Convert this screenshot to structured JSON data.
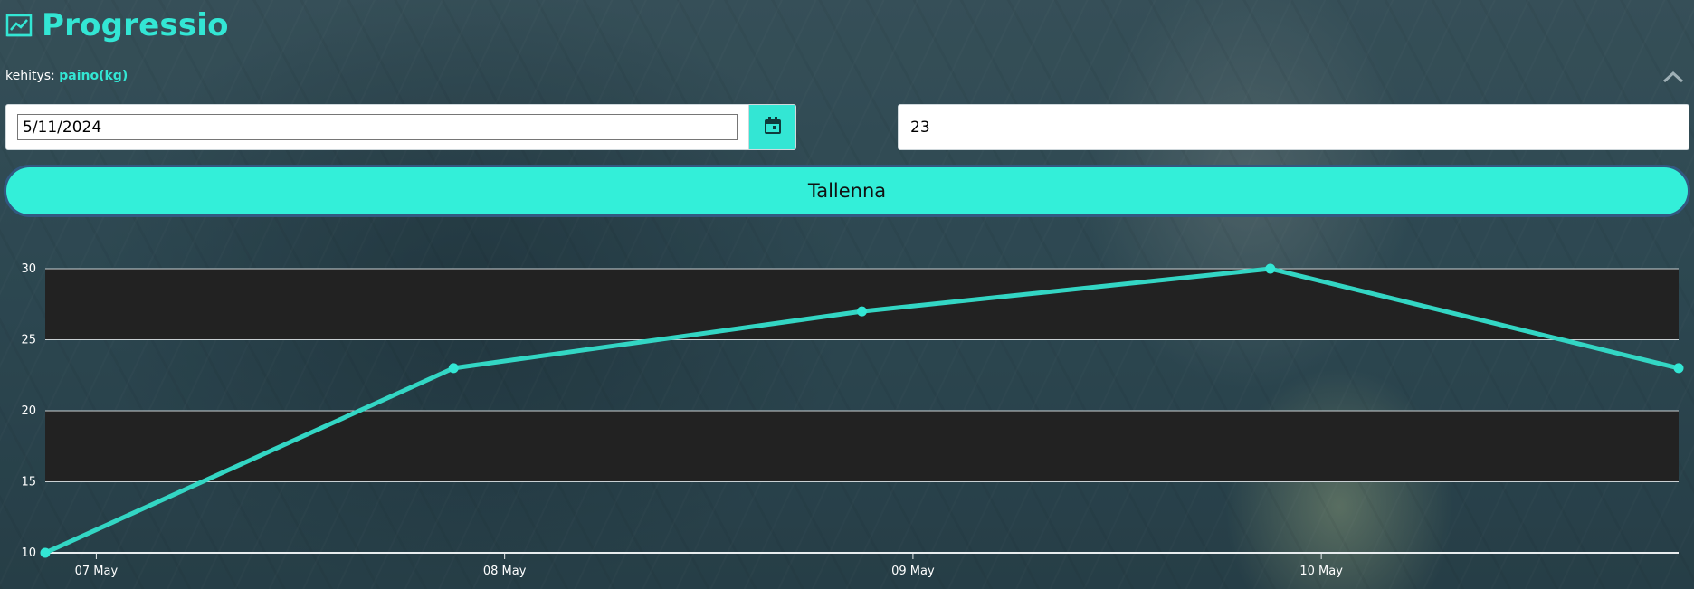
{
  "header": {
    "title": "Progressio",
    "icon": "chart-line-icon"
  },
  "metric": {
    "prefix": "kehitys:",
    "name": "paino(kg)"
  },
  "form": {
    "date_value": "5/11/2024",
    "value_input": "23",
    "save_label": "Tallenna"
  },
  "colors": {
    "accent": "#33e6d4",
    "button": "#33efd9",
    "band": "#222222"
  },
  "chart_data": {
    "type": "line",
    "title": "",
    "xlabel": "",
    "ylabel": "",
    "ylim": [
      10,
      30
    ],
    "yticks": [
      10,
      15,
      20,
      25,
      30
    ],
    "x": [
      "2024-05-06T21:00",
      "2024-05-07T21:00",
      "2024-05-08T21:00",
      "2024-05-09T21:00",
      "2024-05-10T21:00"
    ],
    "values": [
      10,
      23,
      27,
      30,
      23
    ],
    "xticks": [
      "07 May",
      "08 May",
      "09 May",
      "10 May"
    ],
    "grid": true,
    "legend": "none"
  }
}
